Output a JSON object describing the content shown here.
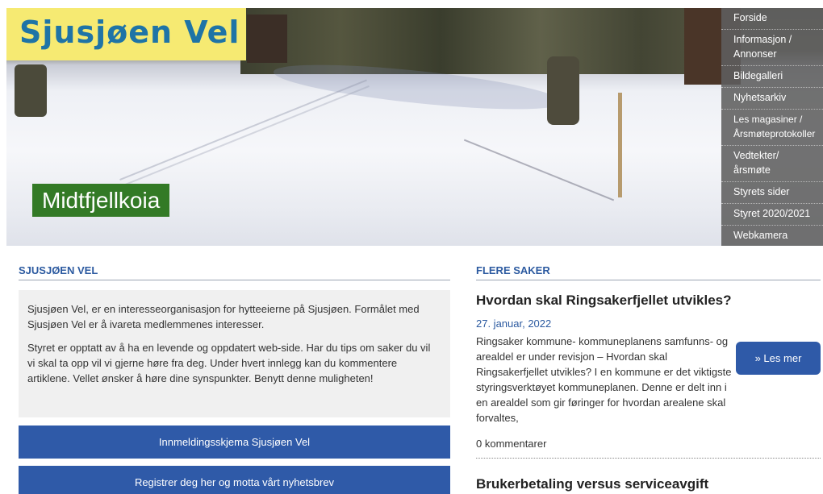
{
  "hero": {
    "logo_text": "Sjusjøen Vel",
    "caption": "Midtfjellkoia"
  },
  "nav": {
    "items": [
      {
        "label": "Forside"
      },
      {
        "label": "Informasjon / Annonser"
      },
      {
        "label": "Bildegalleri"
      },
      {
        "label": "Nyhetsarkiv"
      },
      {
        "label": "Les magasiner / Årsmøteprotokoller"
      },
      {
        "label": "Vedtekter/årsmøte"
      },
      {
        "label": "Styrets sider"
      },
      {
        "label": "Styret 2020/2021"
      },
      {
        "label": "Webkamera"
      }
    ]
  },
  "left": {
    "section_title": "SJUSJØEN VEL",
    "paragraph1": "Sjusjøen Vel, er en interesseorganisasjon for hytteeierne på Sjusjøen. Formålet med Sjusjøen Vel er å ivareta medlemmenes interesser.",
    "paragraph2": "Styret er opptatt av å ha en levende og oppdatert web-side. Har du tips om saker du vil vi skal ta opp vil vi gjerne høre fra deg. Under hvert innlegg kan du kommentere artiklene. Vellet ønsker å høre dine synspunkter. Benytt denne muligheten!",
    "button1": "Innmeldingsskjema Sjusjøen Vel",
    "button2": "Registrer deg her og motta vårt nyhetsbrev"
  },
  "right": {
    "section_title": "FLERE SAKER",
    "article1": {
      "title": "Hvordan skal Ringsakerfjellet utvikles?",
      "date": "27. januar, 2022",
      "excerpt": "Ringsaker kommune- kommuneplanens samfunns- og arealdel er under revisjon – Hvordan skal Ringsakerfjellet utvikles? I en kommune er det viktigste styringsverktøyet kommuneplanen. Denne er delt inn i en arealdel som gir føringer for hvordan arealene skal forvaltes,",
      "read_more": "» Les mer",
      "comments": "0 kommentarer"
    },
    "article2": {
      "title": "Brukerbetaling versus serviceavgift"
    }
  },
  "colors": {
    "primary_blue": "#2f5aa8",
    "logo_yellow": "#f6ea72",
    "logo_blue": "#1f74a6",
    "caption_green": "#337a26",
    "link_blue": "#2c5aa0"
  }
}
